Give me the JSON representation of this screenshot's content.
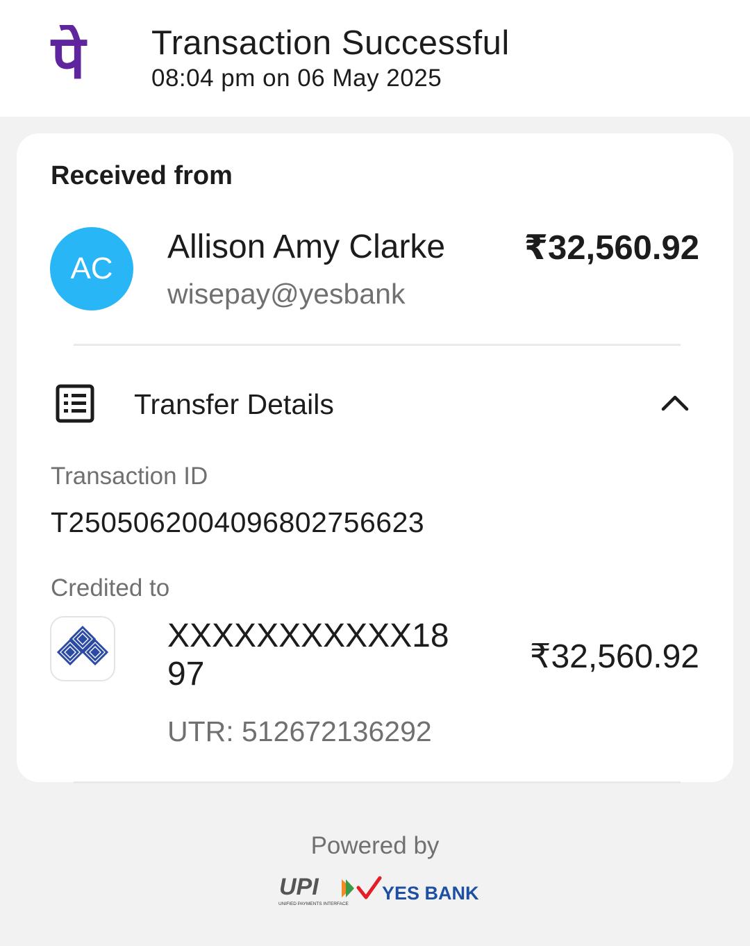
{
  "header": {
    "title": "Transaction Successful",
    "datetime": "08:04 pm on 06 May 2025",
    "logo_glyph": "पे",
    "logo_color": "#5f259f"
  },
  "received": {
    "label": "Received from",
    "avatar_initials": "AC",
    "avatar_color": "#29b6f6",
    "name": "Allison Amy Clarke",
    "vpa": "wisepay@yesbank",
    "amount": "₹32,560.92"
  },
  "transfer_details": {
    "title": "Transfer Details",
    "icon": "list-details-icon",
    "toggle_icon": "chevron-up-icon",
    "transaction_id_label": "Transaction ID",
    "transaction_id": "T2505062004096802756623",
    "credited_to_label": "Credited to",
    "bank_icon": "bank-logo-icon",
    "account_number": "XXXXXXXXXXX1897",
    "utr": "UTR: 512672136292",
    "amount": "₹32,560.92"
  },
  "footer": {
    "powered_by": "Powered by",
    "upi_text": "UPI",
    "upi_tagline": "UNIFIED PAYMENTS INTERFACE",
    "bank_text": "YES BANK"
  }
}
